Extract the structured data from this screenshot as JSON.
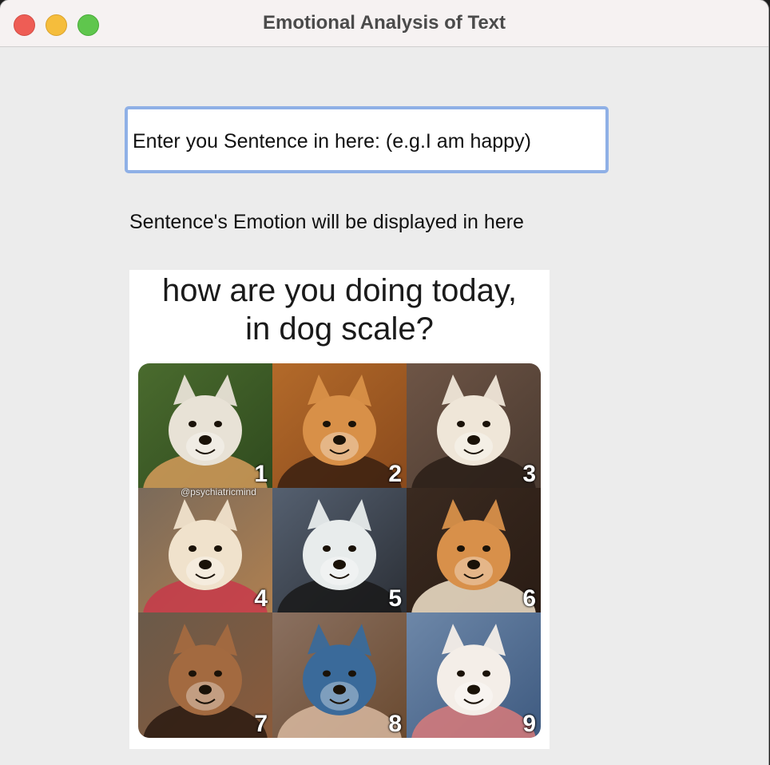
{
  "window": {
    "title": "Emotional Analysis of Text"
  },
  "input": {
    "value": "Enter you Sentence in here: (e.g.I am happy)"
  },
  "result": {
    "text": "Sentence's Emotion will be displayed in here"
  },
  "meme": {
    "title_line1": "how are you doing today,",
    "title_line2": "in dog scale?",
    "watermark": "@psychiatricmind",
    "panels": [
      {
        "number": "1",
        "colors": [
          "#4a6b2e",
          "#2f4a1e",
          "#e8e2d6",
          "#d59b5a"
        ]
      },
      {
        "number": "2",
        "colors": [
          "#b36a2a",
          "#8a4a1c",
          "#d89048",
          "#3a2010"
        ]
      },
      {
        "number": "3",
        "colors": [
          "#6e5546",
          "#4a3a30",
          "#efe6d8",
          "#2a1f18"
        ]
      },
      {
        "number": "4",
        "colors": [
          "#7a6a5a",
          "#b08050",
          "#f0e2cc",
          "#c83a4a"
        ]
      },
      {
        "number": "5",
        "colors": [
          "#556070",
          "#2b2f36",
          "#e8ecec",
          "#1a1a1a"
        ]
      },
      {
        "number": "6",
        "colors": [
          "#3a2a20",
          "#2a1c14",
          "#d8904a",
          "#f3e4cc"
        ]
      },
      {
        "number": "7",
        "colors": [
          "#6a5a4a",
          "#8a5a3a",
          "#a36a40",
          "#2a1a10"
        ]
      },
      {
        "number": "8",
        "colors": [
          "#8a7060",
          "#6a4a30",
          "#3a6a9a",
          "#d8b8a0"
        ]
      },
      {
        "number": "9",
        "colors": [
          "#6d87a8",
          "#3e5a80",
          "#f4eee8",
          "#d87a7a"
        ]
      }
    ]
  }
}
